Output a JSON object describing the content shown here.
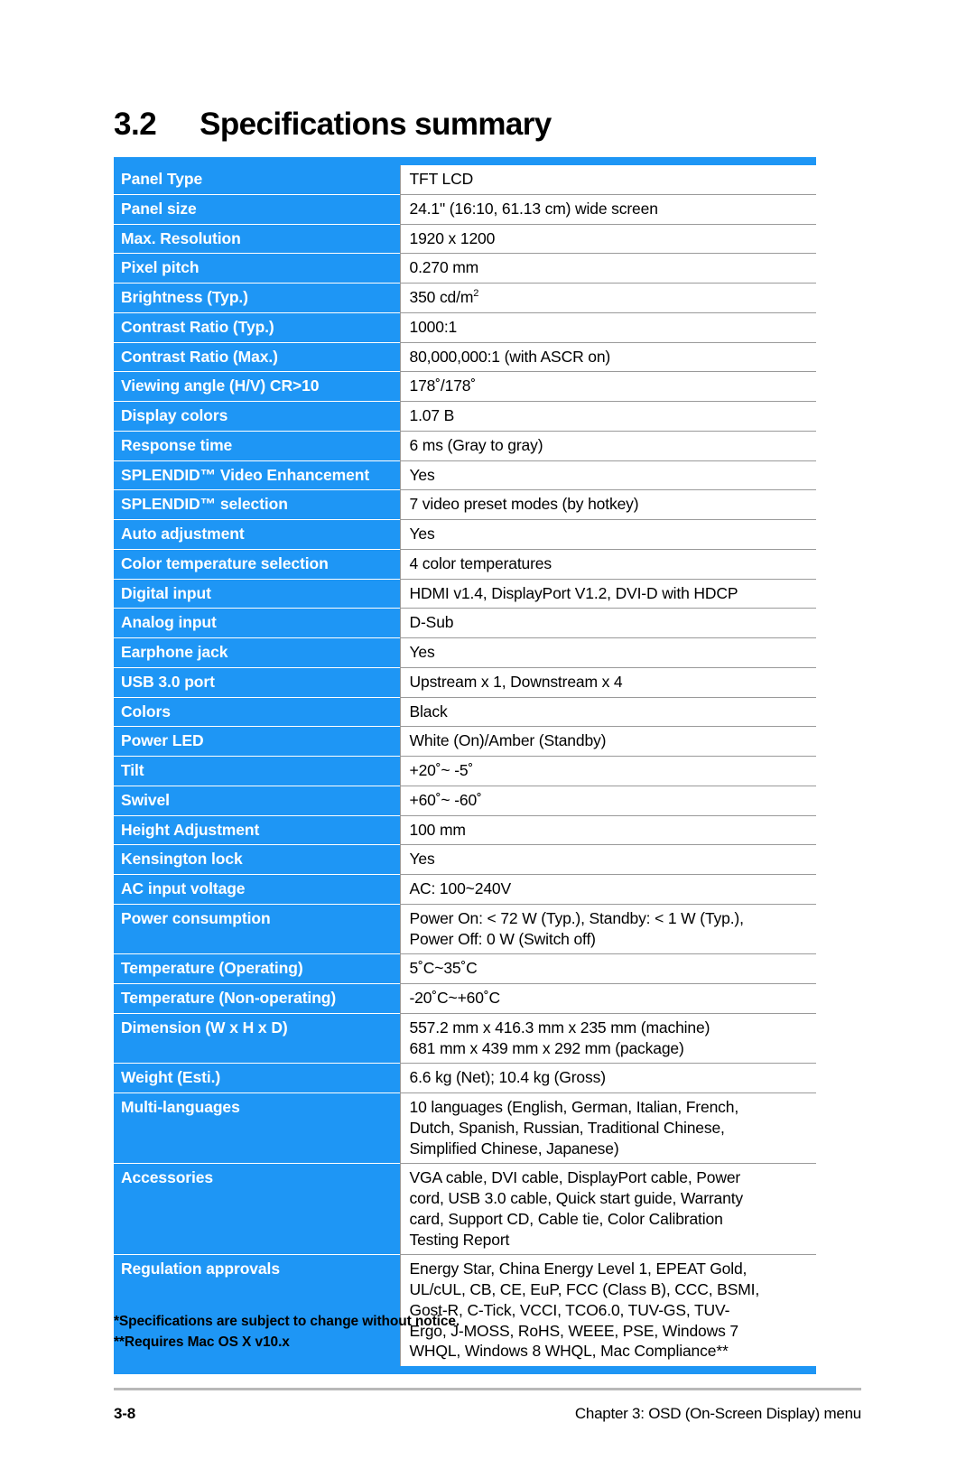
{
  "heading": {
    "number": "3.2",
    "title": "Specifications summary"
  },
  "spec_table": {
    "rows": [
      {
        "label": "Panel Type",
        "value": "TFT LCD"
      },
      {
        "label": "Panel size",
        "value": "24.1\" (16:10, 61.13 cm) wide screen"
      },
      {
        "label": "Max. Resolution",
        "value": "1920 x 1200"
      },
      {
        "label": "Pixel pitch",
        "value": "0.270 mm"
      },
      {
        "label": "Brightness (Typ.)",
        "value": "350 cd/m",
        "value_sup": "2"
      },
      {
        "label": "Contrast Ratio (Typ.)",
        "value": "1000:1"
      },
      {
        "label": "Contrast Ratio (Max.)",
        "value": "80,000,000:1 (with ASCR on)"
      },
      {
        "label": "Viewing angle (H/V) CR>10",
        "value": "178˚/178˚"
      },
      {
        "label": "Display colors",
        "value": "1.07 B"
      },
      {
        "label": "Response time",
        "value": "6 ms (Gray to gray)"
      },
      {
        "label": "SPLENDID™ Video Enhancement",
        "value": "Yes"
      },
      {
        "label": "SPLENDID™ selection",
        "value": "7 video preset modes (by hotkey)"
      },
      {
        "label": "Auto adjustment",
        "value": "Yes"
      },
      {
        "label": "Color temperature selection",
        "value": "4 color temperatures"
      },
      {
        "label": "Digital input",
        "value": "HDMI v1.4, DisplayPort V1.2, DVI-D with HDCP"
      },
      {
        "label": "Analog input",
        "value": "D-Sub"
      },
      {
        "label": "Earphone jack",
        "value": "Yes"
      },
      {
        "label": "USB 3.0 port",
        "value": "Upstream x 1, Downstream x 4"
      },
      {
        "label": "Colors",
        "value": "Black"
      },
      {
        "label": "Power LED",
        "value": "White (On)/Amber (Standby)"
      },
      {
        "label": "Tilt",
        "value": "+20˚~ -5˚"
      },
      {
        "label": "Swivel",
        "value": "+60˚~ -60˚"
      },
      {
        "label": "Height Adjustment",
        "value": "100 mm"
      },
      {
        "label": "Kensington lock",
        "value": "Yes"
      },
      {
        "label": "AC input voltage",
        "value": "AC: 100~240V"
      },
      {
        "label": "Power consumption",
        "value": "Power On: < 72 W (Typ.), Standby: < 1 W (Typ.),\nPower Off: 0 W (Switch off)"
      },
      {
        "label": "Temperature (Operating)",
        "value": "5˚C~35˚C"
      },
      {
        "label": "Temperature (Non-operating)",
        "value": "-20˚C~+60˚C"
      },
      {
        "label": "Dimension (W x H x D)",
        "value": "557.2 mm x 416.3 mm x 235 mm (machine)\n681 mm x 439 mm x 292 mm (package)"
      },
      {
        "label": "Weight (Esti.)",
        "value": "6.6 kg (Net); 10.4 kg (Gross)"
      },
      {
        "label": "Multi-languages",
        "value": "10 languages (English, German, Italian, French,\nDutch, Spanish, Russian, Traditional Chinese,\nSimplified Chinese, Japanese)"
      },
      {
        "label": "Accessories",
        "value": "VGA cable, DVI cable, DisplayPort cable, Power\ncord, USB 3.0 cable, Quick start guide, Warranty\ncard, Support CD, Cable tie, Color Calibration\nTesting Report"
      },
      {
        "label": "Regulation approvals",
        "value": "Energy Star, China Energy Level 1, EPEAT Gold,\nUL/cUL, CB, CE, EuP, FCC (Class B), CCC, BSMI,\nGost-R, C-Tick, VCCI, TCO6.0, TUV-GS, TUV-\nErgo, J-MOSS, RoHS, WEEE, PSE, Windows 7\nWHQL, Windows 8 WHQL, Mac Compliance**"
      }
    ]
  },
  "footnotes": {
    "line1": "*Specifications are subject to change without notice.",
    "line2": "**Requires Mac OS X v10.x"
  },
  "footer": {
    "page_number": "3-8",
    "chapter": "Chapter 3: OSD (On-Screen Display) menu"
  },
  "colors": {
    "accent_blue": "#1e96f5",
    "label_text": "#ffffff",
    "value_text": "#000000",
    "rule_gray": "#b8b8b8",
    "cell_border": "#9a9a9a"
  }
}
